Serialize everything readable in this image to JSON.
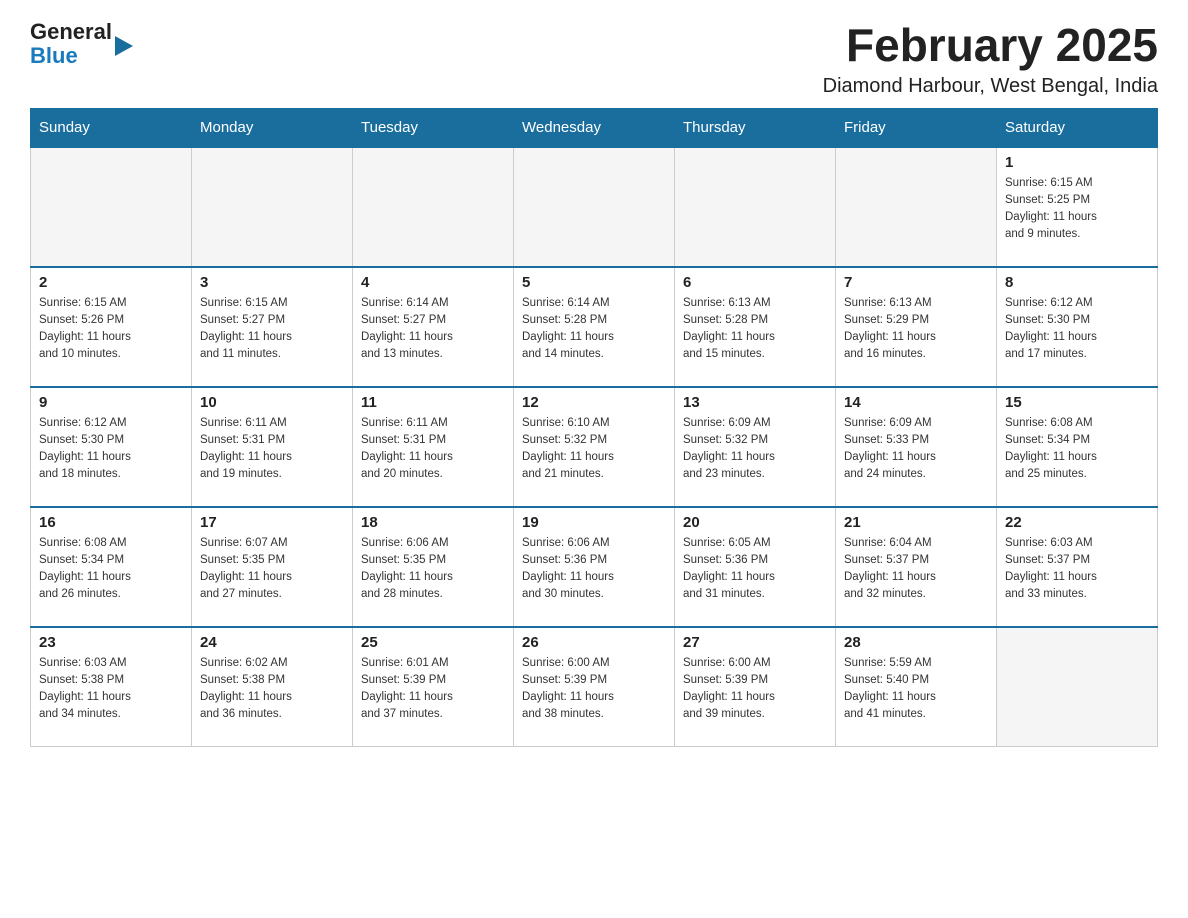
{
  "header": {
    "logo_line1": "General",
    "logo_line2": "Blue",
    "month_title": "February 2025",
    "location": "Diamond Harbour, West Bengal, India"
  },
  "weekdays": [
    "Sunday",
    "Monday",
    "Tuesday",
    "Wednesday",
    "Thursday",
    "Friday",
    "Saturday"
  ],
  "weeks": [
    [
      {
        "day": "",
        "info": ""
      },
      {
        "day": "",
        "info": ""
      },
      {
        "day": "",
        "info": ""
      },
      {
        "day": "",
        "info": ""
      },
      {
        "day": "",
        "info": ""
      },
      {
        "day": "",
        "info": ""
      },
      {
        "day": "1",
        "info": "Sunrise: 6:15 AM\nSunset: 5:25 PM\nDaylight: 11 hours\nand 9 minutes."
      }
    ],
    [
      {
        "day": "2",
        "info": "Sunrise: 6:15 AM\nSunset: 5:26 PM\nDaylight: 11 hours\nand 10 minutes."
      },
      {
        "day": "3",
        "info": "Sunrise: 6:15 AM\nSunset: 5:27 PM\nDaylight: 11 hours\nand 11 minutes."
      },
      {
        "day": "4",
        "info": "Sunrise: 6:14 AM\nSunset: 5:27 PM\nDaylight: 11 hours\nand 13 minutes."
      },
      {
        "day": "5",
        "info": "Sunrise: 6:14 AM\nSunset: 5:28 PM\nDaylight: 11 hours\nand 14 minutes."
      },
      {
        "day": "6",
        "info": "Sunrise: 6:13 AM\nSunset: 5:28 PM\nDaylight: 11 hours\nand 15 minutes."
      },
      {
        "day": "7",
        "info": "Sunrise: 6:13 AM\nSunset: 5:29 PM\nDaylight: 11 hours\nand 16 minutes."
      },
      {
        "day": "8",
        "info": "Sunrise: 6:12 AM\nSunset: 5:30 PM\nDaylight: 11 hours\nand 17 minutes."
      }
    ],
    [
      {
        "day": "9",
        "info": "Sunrise: 6:12 AM\nSunset: 5:30 PM\nDaylight: 11 hours\nand 18 minutes."
      },
      {
        "day": "10",
        "info": "Sunrise: 6:11 AM\nSunset: 5:31 PM\nDaylight: 11 hours\nand 19 minutes."
      },
      {
        "day": "11",
        "info": "Sunrise: 6:11 AM\nSunset: 5:31 PM\nDaylight: 11 hours\nand 20 minutes."
      },
      {
        "day": "12",
        "info": "Sunrise: 6:10 AM\nSunset: 5:32 PM\nDaylight: 11 hours\nand 21 minutes."
      },
      {
        "day": "13",
        "info": "Sunrise: 6:09 AM\nSunset: 5:32 PM\nDaylight: 11 hours\nand 23 minutes."
      },
      {
        "day": "14",
        "info": "Sunrise: 6:09 AM\nSunset: 5:33 PM\nDaylight: 11 hours\nand 24 minutes."
      },
      {
        "day": "15",
        "info": "Sunrise: 6:08 AM\nSunset: 5:34 PM\nDaylight: 11 hours\nand 25 minutes."
      }
    ],
    [
      {
        "day": "16",
        "info": "Sunrise: 6:08 AM\nSunset: 5:34 PM\nDaylight: 11 hours\nand 26 minutes."
      },
      {
        "day": "17",
        "info": "Sunrise: 6:07 AM\nSunset: 5:35 PM\nDaylight: 11 hours\nand 27 minutes."
      },
      {
        "day": "18",
        "info": "Sunrise: 6:06 AM\nSunset: 5:35 PM\nDaylight: 11 hours\nand 28 minutes."
      },
      {
        "day": "19",
        "info": "Sunrise: 6:06 AM\nSunset: 5:36 PM\nDaylight: 11 hours\nand 30 minutes."
      },
      {
        "day": "20",
        "info": "Sunrise: 6:05 AM\nSunset: 5:36 PM\nDaylight: 11 hours\nand 31 minutes."
      },
      {
        "day": "21",
        "info": "Sunrise: 6:04 AM\nSunset: 5:37 PM\nDaylight: 11 hours\nand 32 minutes."
      },
      {
        "day": "22",
        "info": "Sunrise: 6:03 AM\nSunset: 5:37 PM\nDaylight: 11 hours\nand 33 minutes."
      }
    ],
    [
      {
        "day": "23",
        "info": "Sunrise: 6:03 AM\nSunset: 5:38 PM\nDaylight: 11 hours\nand 34 minutes."
      },
      {
        "day": "24",
        "info": "Sunrise: 6:02 AM\nSunset: 5:38 PM\nDaylight: 11 hours\nand 36 minutes."
      },
      {
        "day": "25",
        "info": "Sunrise: 6:01 AM\nSunset: 5:39 PM\nDaylight: 11 hours\nand 37 minutes."
      },
      {
        "day": "26",
        "info": "Sunrise: 6:00 AM\nSunset: 5:39 PM\nDaylight: 11 hours\nand 38 minutes."
      },
      {
        "day": "27",
        "info": "Sunrise: 6:00 AM\nSunset: 5:39 PM\nDaylight: 11 hours\nand 39 minutes."
      },
      {
        "day": "28",
        "info": "Sunrise: 5:59 AM\nSunset: 5:40 PM\nDaylight: 11 hours\nand 41 minutes."
      },
      {
        "day": "",
        "info": ""
      }
    ]
  ]
}
